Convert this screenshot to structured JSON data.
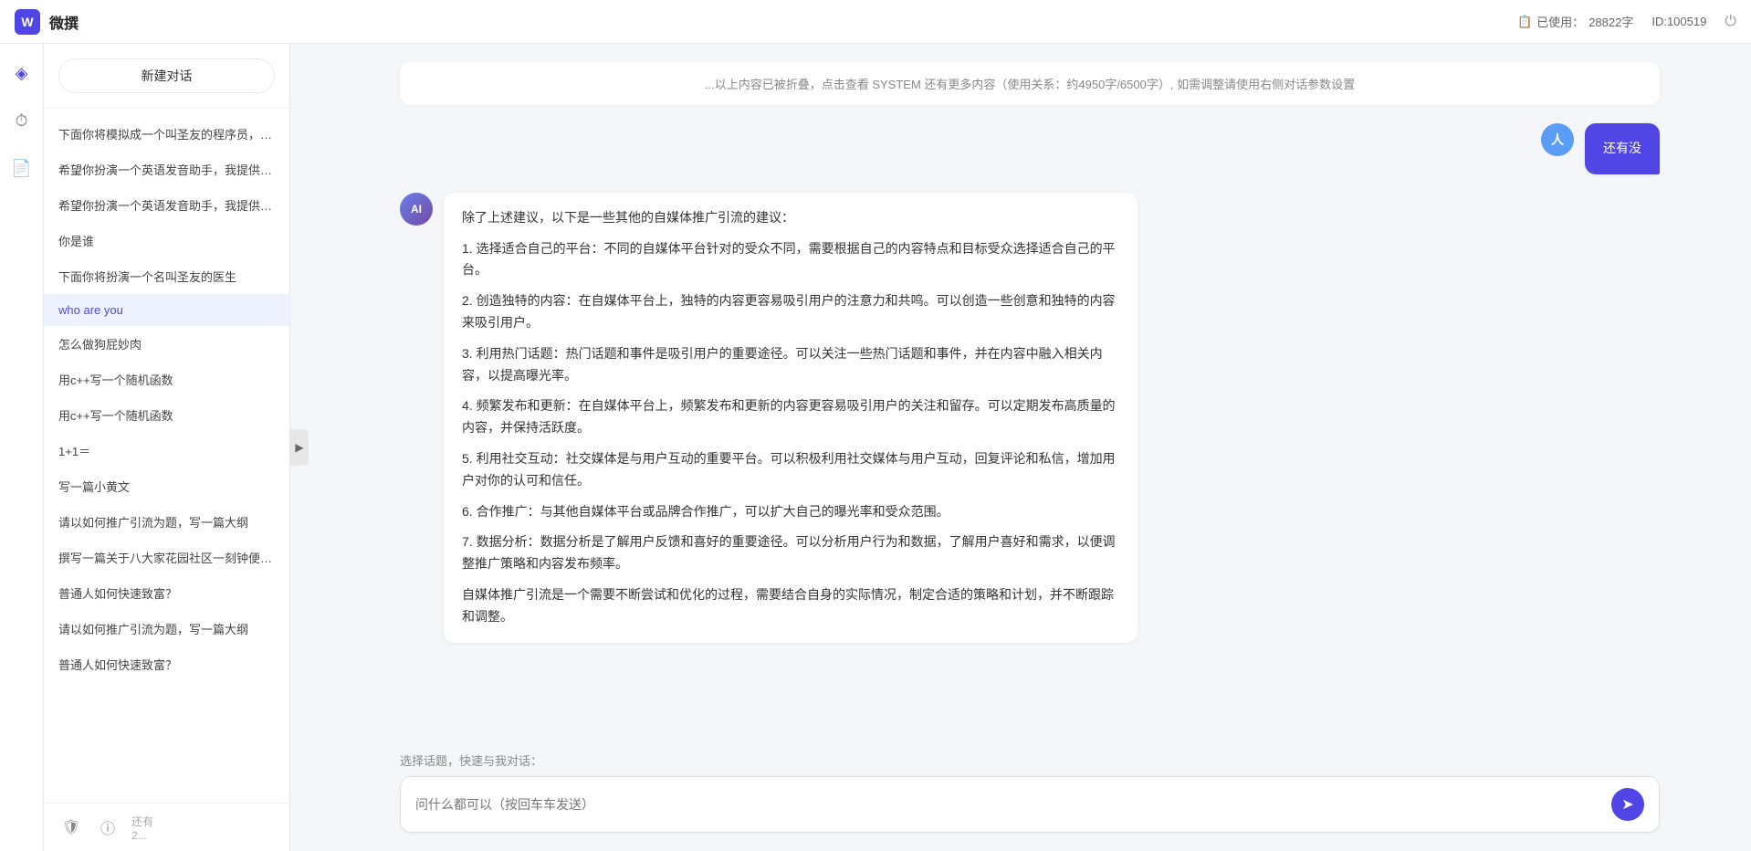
{
  "app": {
    "title": "微撰",
    "logo_letter": "W",
    "usage_label": "已使用：",
    "usage_value": "28822字",
    "user_id": "ID:100519"
  },
  "icons": {
    "power": "⏻",
    "package": "◈",
    "clock": "⏱",
    "file": "📄",
    "shield": "🛡",
    "info": "ⓘ",
    "collapse": "▶",
    "send": "➤",
    "file_icon": "📋"
  },
  "sidebar": {
    "new_chat": "新建对话",
    "items": [
      {
        "label": "下面你将模拟成一个叫圣友的程序员，我说...",
        "active": false
      },
      {
        "label": "希望你扮演一个英语发音助手，我提供给你...",
        "active": false
      },
      {
        "label": "希望你扮演一个英语发音助手，我提供给你...",
        "active": false
      },
      {
        "label": "你是谁",
        "active": false
      },
      {
        "label": "下面你将扮演一个名叫圣友的医生",
        "active": false
      },
      {
        "label": "who are you",
        "active": true
      },
      {
        "label": "怎么做狗屁妙肉",
        "active": false
      },
      {
        "label": "用c++写一个随机函数",
        "active": false
      },
      {
        "label": "用c++写一个随机函数",
        "active": false
      },
      {
        "label": "1+1＝",
        "active": false
      },
      {
        "label": "写一篇小黄文",
        "active": false
      },
      {
        "label": "请以如何推广引流为题，写一篇大纲",
        "active": false
      },
      {
        "label": "撰写一篇关于八大家花园社区一刻钟便民生...",
        "active": false
      },
      {
        "label": "普通人如何快速致富？",
        "active": false
      },
      {
        "label": "请以如何推广引流为题，写一篇大纲",
        "active": false
      },
      {
        "label": "普通人如何快速致富？",
        "active": false
      }
    ],
    "footer_items": [
      "🛡",
      "ⓘ",
      "还有2..."
    ]
  },
  "chat": {
    "truncated_top": "...以上内容已被折叠，点击查看  SYSTEM  还有更多内容（使用关系：约4950字/6500字）, 如需调整请使用右侧对话参数设置",
    "messages": [
      {
        "role": "user",
        "avatar_letter": "人",
        "text": "还有没"
      },
      {
        "role": "assistant",
        "avatar_letter": "AI",
        "paragraphs": [
          "除了上述建议，以下是一些其他的自媒体推广引流的建议：",
          "1. 选择适合自己的平台：不同的自媒体平台针对的受众不同，需要根据自己的内容特点和目标受众选择适合自己的平台。",
          "2. 创造独特的内容：在自媒体平台上，独特的内容更容易吸引用户的注意力和共鸣。可以创造一些创意和独特的内容来吸引用户。",
          "3. 利用热门话题：热门话题和事件是吸引用户的重要途径。可以关注一些热门话题和事件，并在内容中融入相关内容，以提高曝光率。",
          "4. 频繁发布和更新：在自媒体平台上，频繁发布和更新的内容更容易吸引用户的关注和留存。可以定期发布高质量的内容，并保持活跃度。",
          "5. 利用社交互动：社交媒体是与用户互动的重要平台。可以积极利用社交媒体与用户互动，回复评论和私信，增加用户对你的认可和信任。",
          "6. 合作推广：与其他自媒体平台或品牌合作推广，可以扩大自己的曝光率和受众范围。",
          "7. 数据分析：数据分析是了解用户反馈和喜好的重要途径。可以分析用户行为和数据，了解用户喜好和需求，以便调整推广策略和内容发布频率。",
          "自媒体推广引流是一个需要不断尝试和优化的过程，需要结合自身的实际情况，制定合适的策略和计划，并不断跟踪和调整。"
        ]
      }
    ],
    "input": {
      "quick_select": "选择话题，快速与我对话：",
      "placeholder": "问什么都可以（按回车车发送）"
    }
  }
}
